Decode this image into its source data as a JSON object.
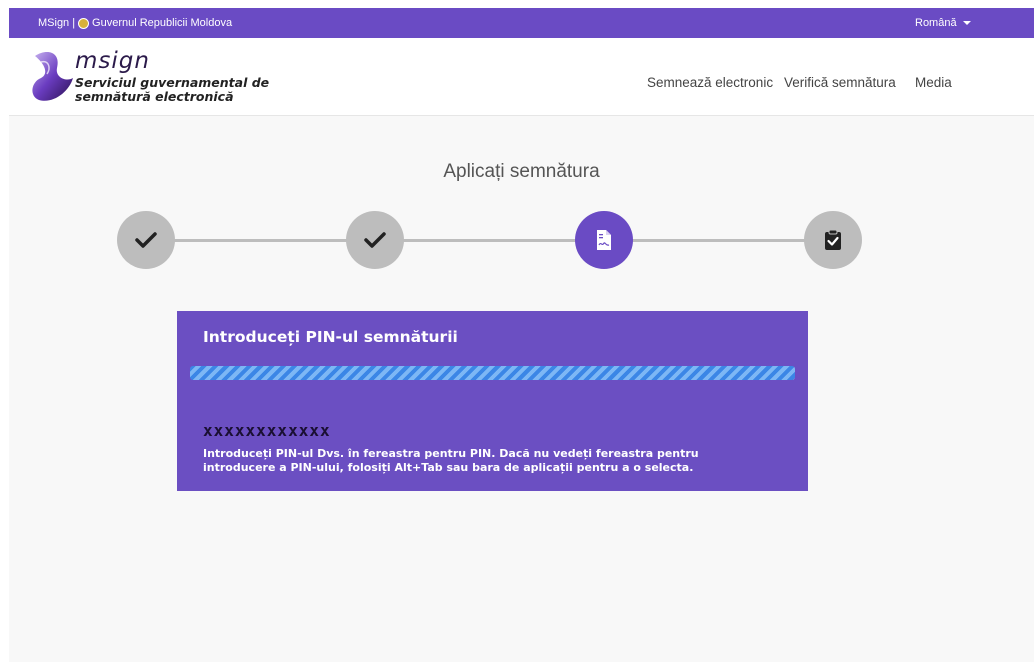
{
  "topbar": {
    "site": "MSign",
    "separator": "|",
    "government": "Guvernul Republicii Moldova",
    "language": "Română"
  },
  "logo": {
    "brand": "msign",
    "subtitle_line1": "Serviciul guvernamental de",
    "subtitle_line2": "semnătură electronică"
  },
  "nav": {
    "items": [
      {
        "label": "Semnează electronic"
      },
      {
        "label": "Verifică semnătura"
      },
      {
        "label": "Media"
      }
    ]
  },
  "page": {
    "title": "Aplicați semnătura"
  },
  "steps": [
    {
      "icon": "check-icon",
      "state": "done"
    },
    {
      "icon": "check-icon",
      "state": "done"
    },
    {
      "icon": "signature-document-icon",
      "state": "active"
    },
    {
      "icon": "clipboard-check-icon",
      "state": "pending"
    }
  ],
  "card": {
    "title": "Introduceți PIN-ul semnăturii",
    "pin_mask": "xxxxxxxxxxxx",
    "message": "Introduceți PIN-ul Dvs. în fereastra pentru PIN. Dacă nu vedeți fereastra pentru introducere a PIN-ului, folosiți Alt+Tab sau bara de aplicații pentru a o selecta."
  },
  "colors": {
    "accent": "#6a4bc4",
    "card": "#6b4fc2",
    "step_inactive": "#bdbdbd",
    "progress": "#3b86e6"
  }
}
